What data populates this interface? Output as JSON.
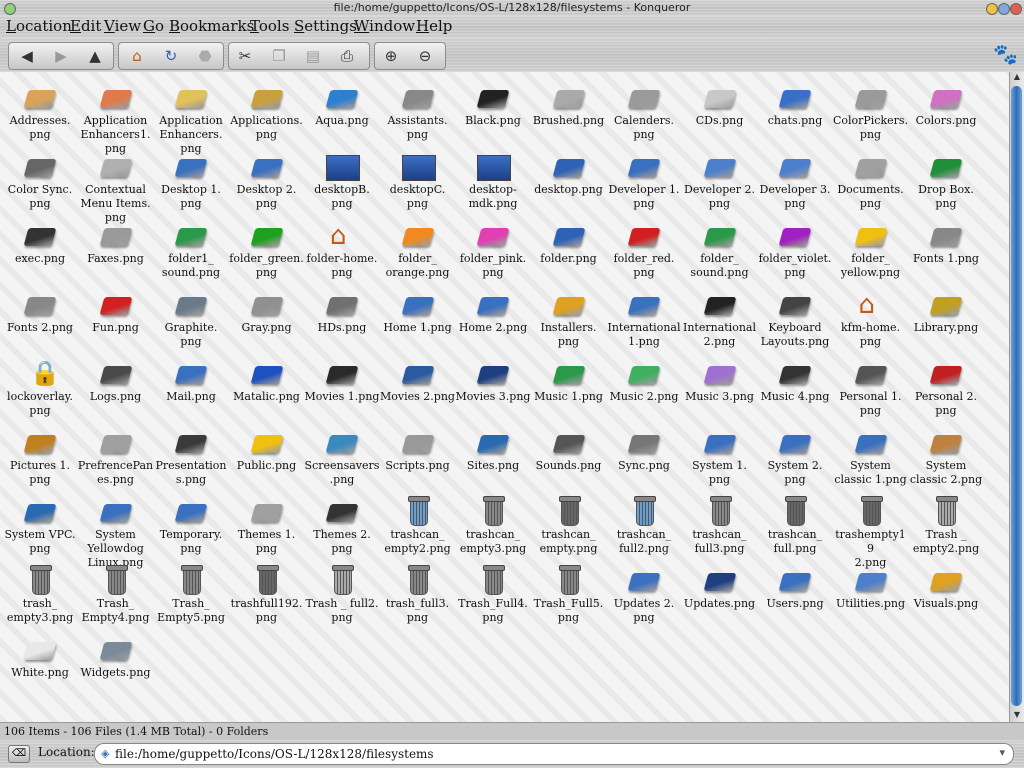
{
  "window": {
    "title": "file:/home/guppetto/Icons/OS-L/128x128/filesystems - Konqueror"
  },
  "menubar": [
    "Location",
    "Edit",
    "View",
    "Go",
    "Bookmarks",
    "Tools",
    "Settings",
    "Window",
    "Help"
  ],
  "toolbar": {
    "buttons": [
      "back-arrow-icon",
      "forward-arrow-icon",
      "up-arrow-icon",
      "home-icon",
      "reload-icon",
      "stop-icon",
      "cut-icon",
      "copy-icon",
      "paste-icon",
      "print-icon",
      "zoom-in-icon",
      "zoom-out-icon"
    ]
  },
  "files": [
    {
      "name": "Addresses.\npng",
      "icon": "folder",
      "color": "#d9a35a"
    },
    {
      "name": "Application\nEnhancers1.\npng",
      "icon": "folder",
      "color": "#e07a4a"
    },
    {
      "name": "Application\nEnhancers.\npng",
      "icon": "folder",
      "color": "#e2c05a"
    },
    {
      "name": "Applications.\npng",
      "icon": "folder",
      "color": "#c8a040"
    },
    {
      "name": "Aqua.png",
      "icon": "folder",
      "color": "#2f7fd0"
    },
    {
      "name": "Assistants.\npng",
      "icon": "folder",
      "color": "#888888"
    },
    {
      "name": "Black.png",
      "icon": "folder",
      "color": "#222222"
    },
    {
      "name": "Brushed.png",
      "icon": "folder",
      "color": "#aaaaaa"
    },
    {
      "name": "Calenders.\npng",
      "icon": "folder",
      "color": "#9a9a9a"
    },
    {
      "name": "CDs.png",
      "icon": "folder",
      "color": "#c8c8c8"
    },
    {
      "name": "chats.png",
      "icon": "folder",
      "color": "#3a6ec8"
    },
    {
      "name": "ColorPickers.\npng",
      "icon": "folder",
      "color": "#9a9a9a"
    },
    {
      "name": "Colors.png",
      "icon": "folder",
      "color": "#d070c0"
    },
    {
      "name": "Color Sync.\npng",
      "icon": "folder",
      "color": "#666666"
    },
    {
      "name": "Contextual\nMenu Items.\npng",
      "icon": "folder",
      "color": "#b0b0b0"
    },
    {
      "name": "Desktop 1.\npng",
      "icon": "folder",
      "color": "#3a70c0"
    },
    {
      "name": "Desktop 2.\npng",
      "icon": "folder",
      "color": "#3a70c0"
    },
    {
      "name": "desktopB.\npng",
      "icon": "screen",
      "color": "#3a70c0"
    },
    {
      "name": "desktopC.\npng",
      "icon": "screen",
      "color": "#3a70c0"
    },
    {
      "name": "desktop-\nmdk.png",
      "icon": "screen",
      "color": "#3a70c0"
    },
    {
      "name": "desktop.png",
      "icon": "folder",
      "color": "#2e62b5"
    },
    {
      "name": "Developer 1.\npng",
      "icon": "folder",
      "color": "#3a70c0"
    },
    {
      "name": "Developer 2.\npng",
      "icon": "folder",
      "color": "#4c80cc"
    },
    {
      "name": "Developer 3.\npng",
      "icon": "folder",
      "color": "#4c80cc"
    },
    {
      "name": "Documents.\npng",
      "icon": "folder",
      "color": "#a0a0a0"
    },
    {
      "name": "Drop Box.\npng",
      "icon": "folder",
      "color": "#1f8f3a"
    },
    {
      "name": "exec.png",
      "icon": "folder",
      "color": "#333333"
    },
    {
      "name": "Faxes.png",
      "icon": "folder",
      "color": "#9a9a9a"
    },
    {
      "name": "folder1_\nsound.png",
      "icon": "folder",
      "color": "#2a9a4a"
    },
    {
      "name": "folder_green.\npng",
      "icon": "folder",
      "color": "#1fa020"
    },
    {
      "name": "folder-home.\npng",
      "icon": "house",
      "color": "#c05a1a"
    },
    {
      "name": "folder_\norange.png",
      "icon": "folder",
      "color": "#f08a20"
    },
    {
      "name": "folder_pink.\npng",
      "icon": "folder",
      "color": "#e040b0"
    },
    {
      "name": "folder.png",
      "icon": "folder",
      "color": "#2e62b5"
    },
    {
      "name": "folder_red.\npng",
      "icon": "folder",
      "color": "#d02020"
    },
    {
      "name": "folder_\nsound.png",
      "icon": "folder",
      "color": "#2a9a4a"
    },
    {
      "name": "folder_violet.\npng",
      "icon": "folder",
      "color": "#a020c0"
    },
    {
      "name": "folder_\nyellow.png",
      "icon": "folder",
      "color": "#f0c010"
    },
    {
      "name": "Fonts 1.png",
      "icon": "folder",
      "color": "#888888"
    },
    {
      "name": "Fonts 2.png",
      "icon": "folder",
      "color": "#888888"
    },
    {
      "name": "Fun.png",
      "icon": "folder",
      "color": "#d02020"
    },
    {
      "name": "Graphite.\npng",
      "icon": "folder",
      "color": "#6a7a8a"
    },
    {
      "name": "Gray.png",
      "icon": "folder",
      "color": "#909090"
    },
    {
      "name": "HDs.png",
      "icon": "folder",
      "color": "#707070"
    },
    {
      "name": "Home 1.png",
      "icon": "folder",
      "color": "#3a70c0"
    },
    {
      "name": "Home 2.png",
      "icon": "folder",
      "color": "#3a70c0"
    },
    {
      "name": "Installers.\npng",
      "icon": "folder",
      "color": "#e0a020"
    },
    {
      "name": "International\n1.png",
      "icon": "folder",
      "color": "#3a70c0"
    },
    {
      "name": "International\n2.png",
      "icon": "folder",
      "color": "#222222"
    },
    {
      "name": "Keyboard\nLayouts.png",
      "icon": "folder",
      "color": "#444444"
    },
    {
      "name": "kfm-home.\npng",
      "icon": "house",
      "color": "#c05a1a"
    },
    {
      "name": "Library.png",
      "icon": "folder",
      "color": "#c0a020"
    },
    {
      "name": "lockoverlay.\npng",
      "icon": "lock",
      "color": "#9a6a30"
    },
    {
      "name": "Logs.png",
      "icon": "folder",
      "color": "#4a4a4a"
    },
    {
      "name": "Mail.png",
      "icon": "folder",
      "color": "#3a70c0"
    },
    {
      "name": "Matalic.png",
      "icon": "folder",
      "color": "#1f50c0"
    },
    {
      "name": "Movies 1.png",
      "icon": "folder",
      "color": "#2a2a2a"
    },
    {
      "name": "Movies 2.png",
      "icon": "folder",
      "color": "#2a5aa0"
    },
    {
      "name": "Movies 3.png",
      "icon": "folder",
      "color": "#1f3f80"
    },
    {
      "name": "Music 1.png",
      "icon": "folder",
      "color": "#2a9a4a"
    },
    {
      "name": "Music 2.png",
      "icon": "folder",
      "color": "#40b060"
    },
    {
      "name": "Music 3.png",
      "icon": "folder",
      "color": "#a070d0"
    },
    {
      "name": "Music 4.png",
      "icon": "folder",
      "color": "#333333"
    },
    {
      "name": "Personal 1.\npng",
      "icon": "folder",
      "color": "#555555"
    },
    {
      "name": "Personal 2.\npng",
      "icon": "folder",
      "color": "#c02020"
    },
    {
      "name": "Pictures 1.\npng",
      "icon": "folder",
      "color": "#c08020"
    },
    {
      "name": "PrefrencePan\nes.png",
      "icon": "folder",
      "color": "#a0a0a0"
    },
    {
      "name": "Presentation\ns.png",
      "icon": "folder",
      "color": "#3a3a3a"
    },
    {
      "name": "Public.png",
      "icon": "folder",
      "color": "#f0c010"
    },
    {
      "name": "Screensavers\n.png",
      "icon": "folder",
      "color": "#3a8ac0"
    },
    {
      "name": "Scripts.png",
      "icon": "folder",
      "color": "#999999"
    },
    {
      "name": "Sites.png",
      "icon": "folder",
      "color": "#2a6ab0"
    },
    {
      "name": "Sounds.png",
      "icon": "folder",
      "color": "#555555"
    },
    {
      "name": "Sync.png",
      "icon": "folder",
      "color": "#777777"
    },
    {
      "name": "System 1.\npng",
      "icon": "folder",
      "color": "#3a70c0"
    },
    {
      "name": "System 2.\npng",
      "icon": "folder",
      "color": "#3a70c0"
    },
    {
      "name": "System\nclassic 1.png",
      "icon": "folder",
      "color": "#3a70c0"
    },
    {
      "name": "System\nclassic 2.png",
      "icon": "folder",
      "color": "#c08040"
    },
    {
      "name": "System VPC.\npng",
      "icon": "folder",
      "color": "#2a6ab0"
    },
    {
      "name": "System\nYellowdog\nLinux.png",
      "icon": "folder",
      "color": "#3a70c0"
    },
    {
      "name": "Temporary.\npng",
      "icon": "folder",
      "color": "#3a70c0"
    },
    {
      "name": "Themes 1.\npng",
      "icon": "folder",
      "color": "#a0a0a0"
    },
    {
      "name": "Themes 2.\npng",
      "icon": "folder",
      "color": "#333333"
    },
    {
      "name": "trashcan_\nempty2.png",
      "icon": "trash",
      "color": "#6aa0d0"
    },
    {
      "name": "trashcan_\nempty3.png",
      "icon": "trash",
      "color": "#888888"
    },
    {
      "name": "trashcan_\nempty.png",
      "icon": "trash",
      "color": "#666666"
    },
    {
      "name": "trashcan_\nfull2.png",
      "icon": "trash",
      "color": "#6aa0d0"
    },
    {
      "name": "trashcan_\nfull3.png",
      "icon": "trash",
      "color": "#888888"
    },
    {
      "name": "trashcan_\nfull.png",
      "icon": "trash",
      "color": "#666666"
    },
    {
      "name": "trashempty19\n2.png",
      "icon": "trash",
      "color": "#666666"
    },
    {
      "name": "Trash _\nempty2.png",
      "icon": "trash",
      "color": "#aaaaaa"
    },
    {
      "name": "trash_\nempty3.png",
      "icon": "trash",
      "color": "#888888"
    },
    {
      "name": "Trash_\nEmpty4.png",
      "icon": "trash",
      "color": "#888888"
    },
    {
      "name": "Trash_\nEmpty5.png",
      "icon": "trash",
      "color": "#888888"
    },
    {
      "name": "trashfull192.\npng",
      "icon": "trash",
      "color": "#666666"
    },
    {
      "name": "Trash _ full2.\npng",
      "icon": "trash",
      "color": "#aaaaaa"
    },
    {
      "name": "trash_full3.\npng",
      "icon": "trash",
      "color": "#888888"
    },
    {
      "name": "Trash_Full4.\npng",
      "icon": "trash",
      "color": "#888888"
    },
    {
      "name": "Trash_Full5.\npng",
      "icon": "trash",
      "color": "#888888"
    },
    {
      "name": "Updates 2.\npng",
      "icon": "folder",
      "color": "#3a70c0"
    },
    {
      "name": "Updates.png",
      "icon": "folder",
      "color": "#1f3f80"
    },
    {
      "name": "Users.png",
      "icon": "folder",
      "color": "#3a70c0"
    },
    {
      "name": "Utilities.png",
      "icon": "folder",
      "color": "#4c80cc"
    },
    {
      "name": "Visuals.png",
      "icon": "folder",
      "color": "#e0a020"
    },
    {
      "name": "White.png",
      "icon": "folder",
      "color": "#e8e8e8"
    },
    {
      "name": "Widgets.png",
      "icon": "folder",
      "color": "#7a8a9a"
    }
  ],
  "statusbar": {
    "text": "106 Items - 106 Files (1.4 MB Total) - 0 Folders"
  },
  "locationbar": {
    "label": "Location:",
    "value": "file:/home/guppetto/Icons/OS-L/128x128/filesystems"
  }
}
